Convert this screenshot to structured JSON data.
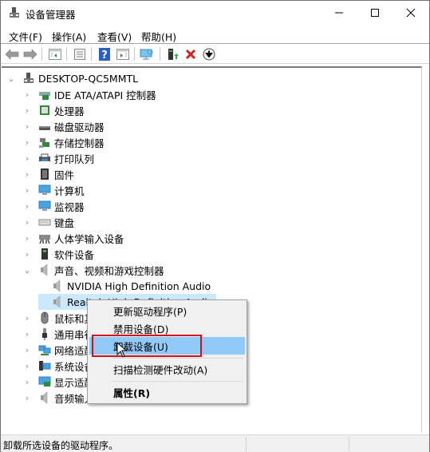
{
  "window": {
    "title": "设备管理器",
    "controls": {
      "minimize": "minimize-icon",
      "maximize": "maximize-icon",
      "close": "close-icon"
    }
  },
  "menubar": {
    "items": [
      "文件(F)",
      "操作(A)",
      "查看(V)",
      "帮助(H)"
    ]
  },
  "toolbar": {
    "buttons": [
      "back-arrow-icon",
      "forward-arrow-icon",
      "show-hide-console-tree-icon",
      "properties-icon",
      "help-icon",
      "action-pane-icon",
      "scan-hardware-icon",
      "update-driver-icon",
      "uninstall-icon",
      "disable-icon"
    ]
  },
  "tree": {
    "root": "DESKTOP-QC5MMTL",
    "items": [
      {
        "label": "IDE ATA/ATAPI 控制器",
        "icon": "ide-controller-icon",
        "expanded": false
      },
      {
        "label": "处理器",
        "icon": "processor-icon",
        "expanded": false
      },
      {
        "label": "磁盘驱动器",
        "icon": "disk-drive-icon",
        "expanded": false
      },
      {
        "label": "存储控制器",
        "icon": "storage-controller-icon",
        "expanded": false
      },
      {
        "label": "打印队列",
        "icon": "printer-icon",
        "expanded": false
      },
      {
        "label": "固件",
        "icon": "firmware-icon",
        "expanded": false
      },
      {
        "label": "计算机",
        "icon": "computer-icon",
        "expanded": false
      },
      {
        "label": "监视器",
        "icon": "monitor-icon",
        "expanded": false
      },
      {
        "label": "键盘",
        "icon": "keyboard-icon",
        "expanded": false
      },
      {
        "label": "人体学输入设备",
        "icon": "hid-icon",
        "expanded": false
      },
      {
        "label": "软件设备",
        "icon": "software-device-icon",
        "expanded": false
      },
      {
        "label": "声音、视频和游戏控制器",
        "icon": "speaker-icon",
        "expanded": true,
        "children": [
          {
            "label": "NVIDIA High Definition Audio",
            "icon": "speaker-icon"
          },
          {
            "label": "Realtek High Definition Audio",
            "icon": "speaker-icon",
            "selected": true
          }
        ]
      },
      {
        "label": "鼠标和其他指针设备",
        "icon": "mouse-icon",
        "expanded": false
      },
      {
        "label": "通用串行总线控制器",
        "icon": "usb-icon",
        "expanded": false
      },
      {
        "label": "网络适配器",
        "icon": "network-adapter-icon",
        "expanded": false
      },
      {
        "label": "系统设备",
        "icon": "system-device-icon",
        "expanded": false
      },
      {
        "label": "显示适配器",
        "icon": "display-adapter-icon",
        "expanded": false
      },
      {
        "label": "音频输入和输出",
        "icon": "speaker-icon",
        "expanded": false
      }
    ]
  },
  "context_menu": {
    "items": [
      {
        "label": "更新驱动程序(P)"
      },
      {
        "label": "禁用设备(D)"
      },
      {
        "label": "卸载设备(U)",
        "highlighted": true
      },
      {
        "label": "扫描检测硬件改动(A)"
      },
      {
        "label": "属性(R)",
        "bold": true
      }
    ]
  },
  "statusbar": {
    "text": "卸载所选设备的驱动程序。"
  },
  "colors": {
    "selection": "#cce8ff",
    "menu_highlight": "#91c9f7",
    "annotation_box": "#d0101c"
  }
}
